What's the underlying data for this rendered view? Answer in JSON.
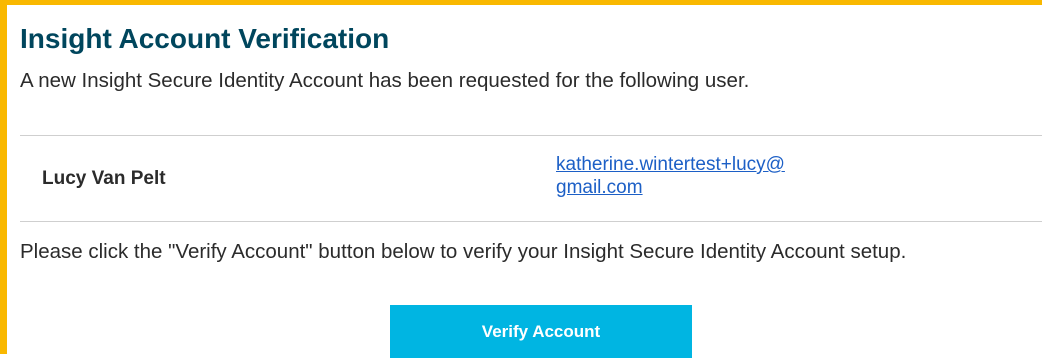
{
  "email": {
    "title": "Insight Account Verification",
    "intro_text": "A new Insight Secure Identity Account has been requested for the following user.",
    "user": {
      "name": "Lucy Van Pelt",
      "email_line1": "katherine.wintertest+lucy@",
      "email_line2": "gmail.com"
    },
    "instructions": "Please click the \"Verify Account\" button below to verify your Insight Secure Identity Account setup.",
    "verify_button_label": "Verify Account"
  },
  "colors": {
    "accent_border": "#f9b800",
    "title": "#00465d",
    "link": "#1c5fc6",
    "button": "#00b5e2"
  }
}
